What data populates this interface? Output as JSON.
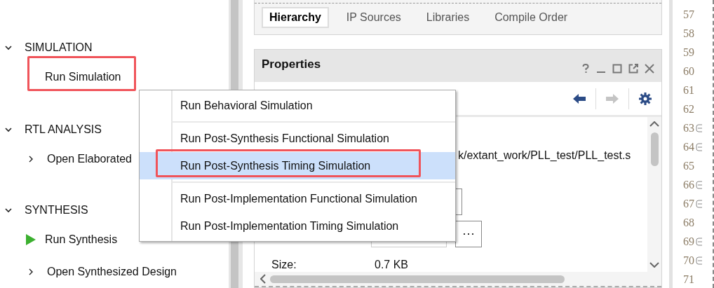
{
  "flow_navigator": {
    "sections": [
      {
        "title": "SIMULATION",
        "expanded": true,
        "items": [
          {
            "label": "Run Simulation",
            "kind": "plain",
            "highlighted": true
          }
        ]
      },
      {
        "title": "RTL ANALYSIS",
        "expanded": true,
        "items": [
          {
            "label": "Open Elaborated",
            "kind": "expandable",
            "highlighted": false
          }
        ]
      },
      {
        "title": "SYNTHESIS",
        "expanded": true,
        "items": [
          {
            "label": "Run Synthesis",
            "kind": "run",
            "highlighted": false
          },
          {
            "label": "Open Synthesized Design",
            "kind": "expandable",
            "highlighted": false
          }
        ]
      }
    ]
  },
  "sources": {
    "tabs": [
      {
        "label": "Hierarchy",
        "selected": true
      },
      {
        "label": "IP Sources",
        "selected": false
      },
      {
        "label": "Libraries",
        "selected": false
      },
      {
        "label": "Compile Order",
        "selected": false
      }
    ]
  },
  "properties": {
    "title": "Properties",
    "back_disabled": false,
    "forward_disabled": true,
    "path": "k/extant_work/PLL_test/PLL_test.s",
    "size_label": "Size:",
    "size_value": "0.7 KB"
  },
  "editor": {
    "lines": [
      {
        "number": "57",
        "fold": false
      },
      {
        "number": "58",
        "fold": false
      },
      {
        "number": "59",
        "fold": false
      },
      {
        "number": "60",
        "fold": false
      },
      {
        "number": "61",
        "fold": false
      },
      {
        "number": "62",
        "fold": false
      },
      {
        "number": "63",
        "fold": true
      },
      {
        "number": "64",
        "fold": true
      },
      {
        "number": "65",
        "fold": false
      },
      {
        "number": "66",
        "fold": true
      },
      {
        "number": "67",
        "fold": true
      },
      {
        "number": "68",
        "fold": false
      },
      {
        "number": "69",
        "fold": true
      },
      {
        "number": "70",
        "fold": true
      },
      {
        "number": "71",
        "fold": false
      }
    ]
  },
  "context_menu": {
    "groups": [
      [
        {
          "label": "Run Behavioral Simulation",
          "selected": false,
          "highlighted": false
        }
      ],
      [
        {
          "label": "Run Post-Synthesis Functional Simulation",
          "selected": false,
          "highlighted": false
        },
        {
          "label": "Run Post-Synthesis Timing Simulation",
          "selected": true,
          "highlighted": true
        }
      ],
      [
        {
          "label": "Run Post-Implementation Functional Simulation",
          "selected": false,
          "highlighted": false
        },
        {
          "label": "Run Post-Implementation Timing Simulation",
          "selected": false,
          "highlighted": false
        }
      ]
    ]
  }
}
